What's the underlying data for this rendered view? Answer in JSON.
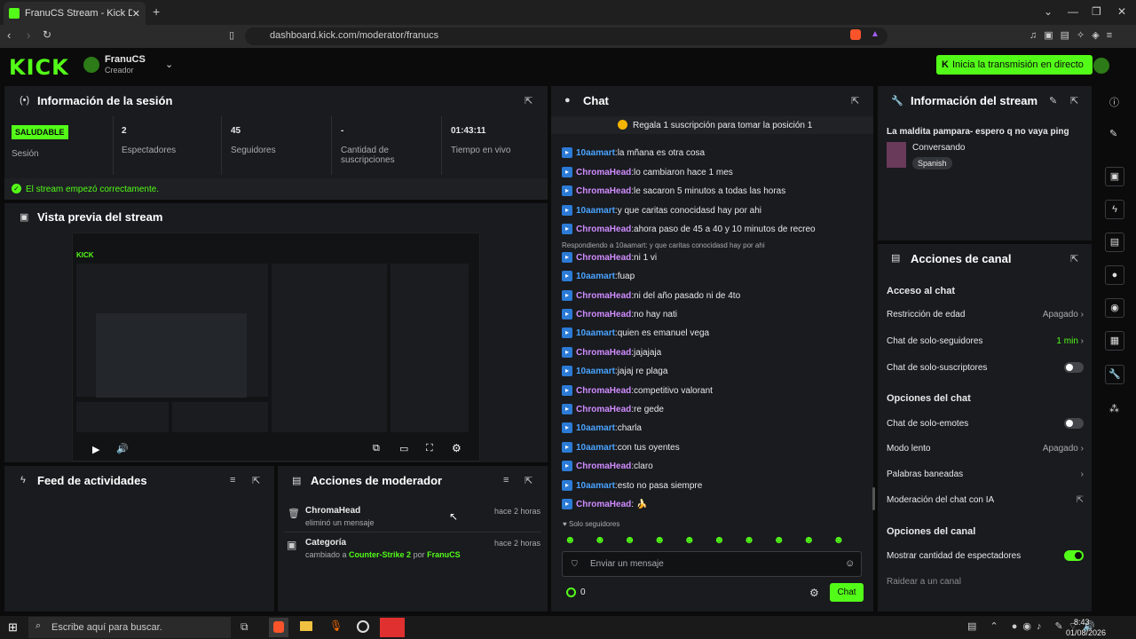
{
  "browser": {
    "tab_title": "FranuCS Stream - Kick Dashboard",
    "url": "dashboard.kick.com/moderator/franucs"
  },
  "header": {
    "logo": "KICK",
    "channel_name": "FranuCS",
    "channel_role": "Creador",
    "go_live": "Inicia la transmisión en directo"
  },
  "session": {
    "title": "Información de la sesión",
    "status_badge": "SALUDABLE",
    "status_label": "Sesión",
    "stats": [
      {
        "value": "2",
        "label": "Espectadores"
      },
      {
        "value": "45",
        "label": "Seguidores"
      },
      {
        "value": "-",
        "label": "Cantidad de suscripciones"
      },
      {
        "value": "01:43:11",
        "label": "Tiempo en vivo"
      }
    ],
    "ok_message": "El stream empezó correctamente."
  },
  "preview": {
    "title": "Vista previa del stream"
  },
  "feed": {
    "title": "Feed de actividades"
  },
  "modactions": {
    "title": "Acciones de moderador",
    "items": [
      {
        "title": "ChromaHead",
        "desc": "eliminó un mensaje",
        "time": "hace 2 horas"
      },
      {
        "title": "Categoría",
        "desc_prefix": "cambiado a",
        "game": "Counter-Strike 2",
        "by": "por",
        "user": "FranuCS",
        "time": "hace 2 horas"
      }
    ]
  },
  "chat": {
    "title": "Chat",
    "pinned": "Regala 1 suscripción para tomar la posición 1",
    "reply_note": "Respondiendo a 10aamart: y que caritas conocidasd hay por ahi",
    "messages": [
      {
        "user": "10aamart",
        "text": "la mñana es otra cosa"
      },
      {
        "user": "ChromaHead",
        "text": "lo cambiaron hace 1 mes"
      },
      {
        "user": "ChromaHead",
        "text": "le sacaron 5 minutos a todas las horas"
      },
      {
        "user": "10aamart",
        "text": "y que caritas conocidasd hay por ahi"
      },
      {
        "user": "ChromaHead",
        "text": "ahora paso de 45 a 40 y 10 minutos de recreo"
      },
      {
        "user": "ChromaHead",
        "text": "ni 1 vi"
      },
      {
        "user": "10aamart",
        "text": "fuap"
      },
      {
        "user": "ChromaHead",
        "text": "ni del año pasado ni de 4to"
      },
      {
        "user": "ChromaHead",
        "text": "no hay nati"
      },
      {
        "user": "10aamart",
        "text": "quien es emanuel vega"
      },
      {
        "user": "ChromaHead",
        "text": "jajajaja"
      },
      {
        "user": "10aamart",
        "text": "jajaj re plaga"
      },
      {
        "user": "ChromaHead",
        "text": "competitivo valorant"
      },
      {
        "user": "ChromaHead",
        "text": "re gede"
      },
      {
        "user": "10aamart",
        "text": "charla"
      },
      {
        "user": "10aamart",
        "text": "con tus oyentes"
      },
      {
        "user": "ChromaHead",
        "text": "claro"
      },
      {
        "user": "10aamart",
        "text": "esto no pasa siempre"
      },
      {
        "user": "ChromaHead",
        "text": ""
      }
    ],
    "followers_only": "Solo seguidores",
    "input_placeholder": "Enviar un mensaje",
    "count": "0",
    "send": "Chat"
  },
  "streaminfo": {
    "title": "Información del stream",
    "stream_title": "La maldita pampara- espero q no vaya ping",
    "category": "Conversando",
    "language": "Spanish"
  },
  "channelactions": {
    "title": "Acciones de canal",
    "chat_access": "Acceso al chat",
    "age": {
      "label": "Restricción de edad",
      "value": "Apagado"
    },
    "followers": {
      "label": "Chat de solo-seguidores",
      "value": "1 min"
    },
    "subs": {
      "label": "Chat de solo-suscriptores"
    },
    "chat_options": "Opciones del chat",
    "emotes": {
      "label": "Chat de solo-emotes"
    },
    "slow": {
      "label": "Modo lento",
      "value": "Apagado"
    },
    "banned": {
      "label": "Palabras baneadas"
    },
    "ai": {
      "label": "Moderación del chat con IA"
    },
    "channel_options": "Opciones del canal",
    "viewers": {
      "label": "Mostrar cantidad de espectadores"
    },
    "raid": {
      "label": "Raidear a un canal"
    }
  },
  "taskbar": {
    "search": "Escribe aquí para buscar.",
    "time": "8:43",
    "date": "01/08/2026"
  },
  "colors": {
    "accent": "#53fc18",
    "panel": "#191b1f"
  }
}
